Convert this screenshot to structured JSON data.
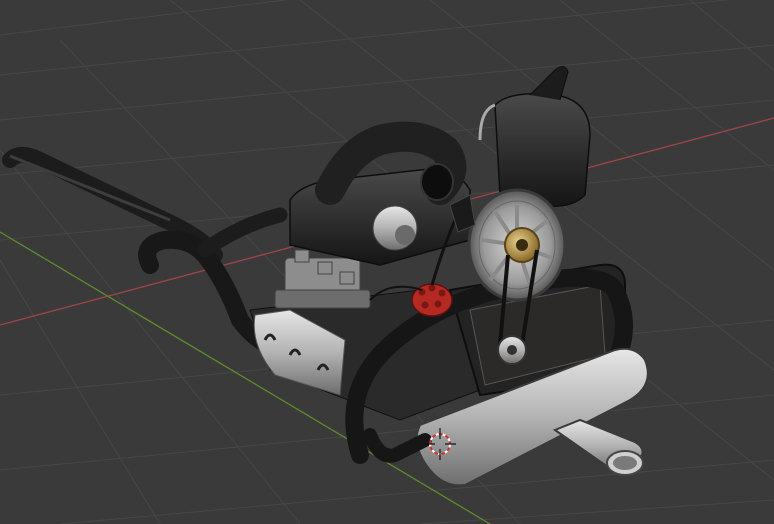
{
  "viewport": {
    "view": "3d-viewport-perspective",
    "background_color": "#3a3a3a",
    "grid_color": "#4a4a4a",
    "x_axis_color": "#c0504d",
    "y_axis_color": "#6b9a2f",
    "object": "engine-model",
    "cursor_icon": "3d-cursor-icon"
  }
}
